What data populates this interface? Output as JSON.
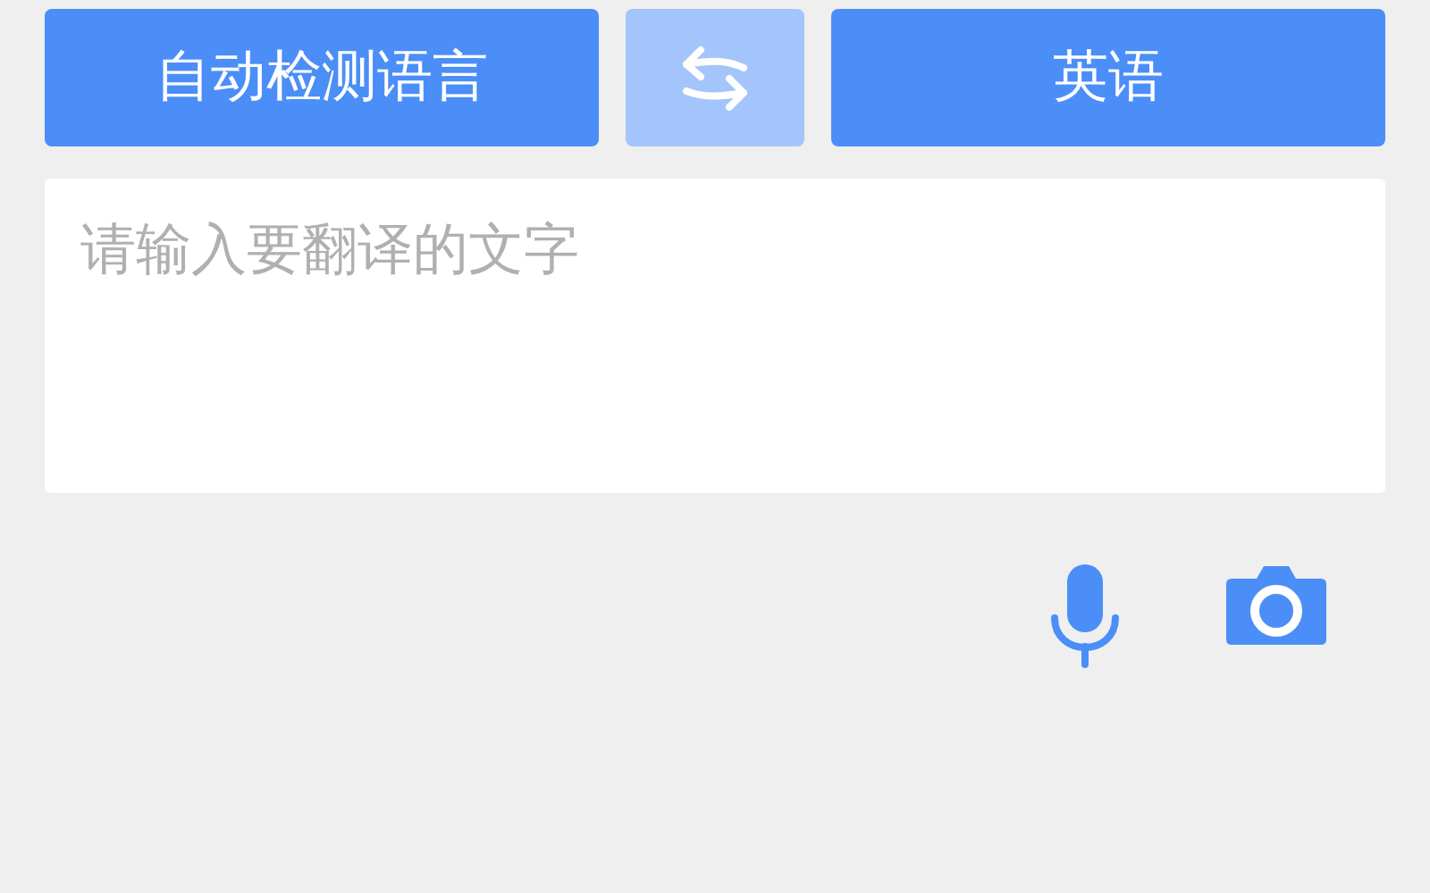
{
  "source_language": {
    "label": "自动检测语言"
  },
  "swap_button": {
    "disabled": true
  },
  "target_language": {
    "label": "英语"
  },
  "input": {
    "placeholder": "请输入要翻译的文字"
  }
}
